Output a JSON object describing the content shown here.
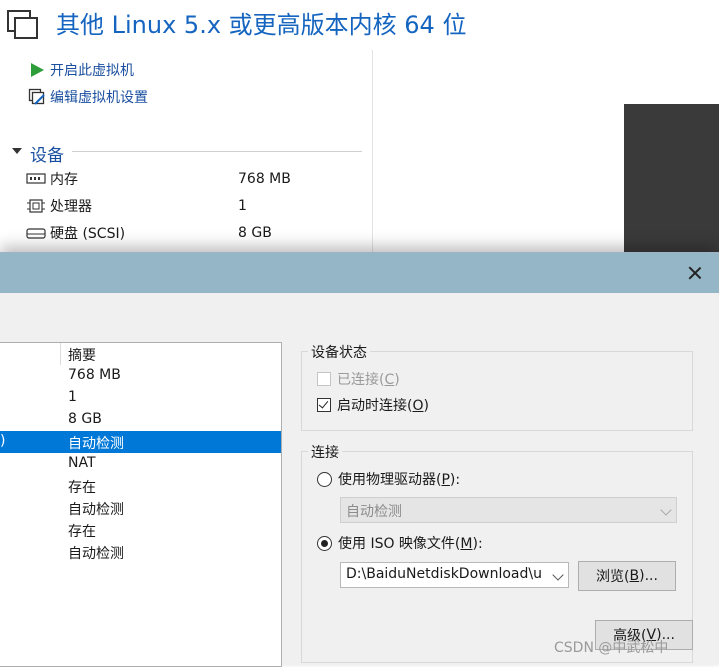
{
  "vm": {
    "title": "其他 Linux 5.x 或更高版本内核 64 位",
    "actions": [
      {
        "label": "开启此虚拟机",
        "icon": "play-icon"
      },
      {
        "label": "编辑虚拟机设置",
        "icon": "edit-settings-icon"
      }
    ],
    "devices_header": "设备",
    "devices": [
      {
        "label": "内存",
        "value": "768 MB",
        "icon": "memory-icon"
      },
      {
        "label": "处理器",
        "value": "1",
        "icon": "cpu-icon"
      },
      {
        "label": "硬盘 (SCSI)",
        "value": "8 GB",
        "icon": "harddisk-icon"
      }
    ]
  },
  "dialog": {
    "hardware_list": {
      "header": "摘要",
      "rows": [
        {
          "prefix": "",
          "summary": "768 MB"
        },
        {
          "prefix": "",
          "summary": "1"
        },
        {
          "prefix": "",
          "summary": "8 GB"
        },
        {
          "prefix": ")",
          "summary": "自动检测",
          "selected": true
        },
        {
          "prefix": "",
          "summary": "NAT"
        },
        {
          "prefix": "",
          "summary": "存在"
        },
        {
          "prefix": "",
          "summary": "自动检测"
        },
        {
          "prefix": "",
          "summary": "存在"
        },
        {
          "prefix": "",
          "summary": "自动检测"
        }
      ]
    },
    "device_status": {
      "title": "设备状态",
      "connected": {
        "pre": "已连接(",
        "key": "C",
        "post": ")",
        "checked": false,
        "disabled": true
      },
      "connect_at_power_on": {
        "pre": "启动时连接(",
        "key": "O",
        "post": ")",
        "checked": true
      }
    },
    "connection": {
      "title": "连接",
      "physical": {
        "pre": "使用物理驱动器(",
        "key": "P",
        "post": "):",
        "selected": false
      },
      "physical_value": "自动检测",
      "iso": {
        "pre": "使用 ISO 映像文件(",
        "key": "M",
        "post": "):",
        "selected": true
      },
      "iso_path": "D:\\BaiduNetdiskDownload\\unio",
      "browse": {
        "pre": "浏览(",
        "key": "B",
        "post": ")..."
      }
    },
    "advanced": {
      "pre": "高级(",
      "key": "V",
      "post": ")..."
    }
  },
  "watermark": "CSDN @中武松中",
  "colors": {
    "accent": "#1565c0",
    "selection": "#0078d7",
    "titlebar": "#95b6c7"
  }
}
